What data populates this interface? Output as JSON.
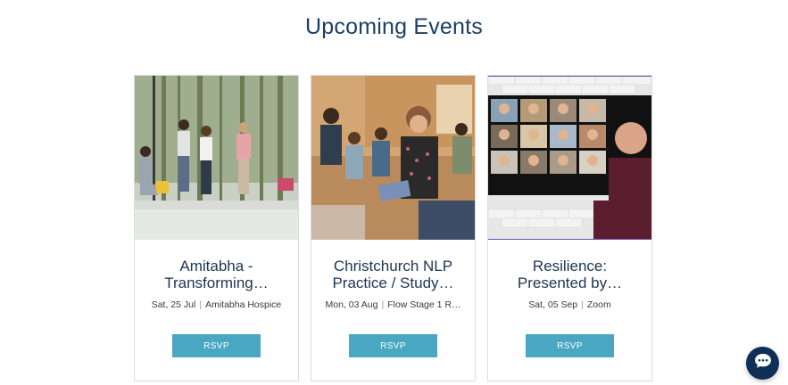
{
  "section": {
    "title": "Upcoming Events"
  },
  "events": [
    {
      "title_line1": "Amitabha -",
      "title_line2": "Transforming…",
      "date": "Sat, 25 Jul",
      "location": "Amitabha Hospice",
      "rsvp_label": "RSVP"
    },
    {
      "title_line1": "Christchurch NLP",
      "title_line2": "Practice / Study…",
      "date": "Mon, 03 Aug",
      "location": "Flow Stage 1 R…",
      "rsvp_label": "RSVP"
    },
    {
      "title_line1": "Resilience:",
      "title_line2": "Presented by…",
      "date": "Sat, 05 Sep",
      "location": "Zoom",
      "rsvp_label": "RSVP"
    }
  ],
  "chat": {
    "icon": "chat-bubble-icon"
  },
  "colors": {
    "heading": "#1c3f66",
    "button": "#4aa7c1",
    "chat": "#0f2f57"
  }
}
